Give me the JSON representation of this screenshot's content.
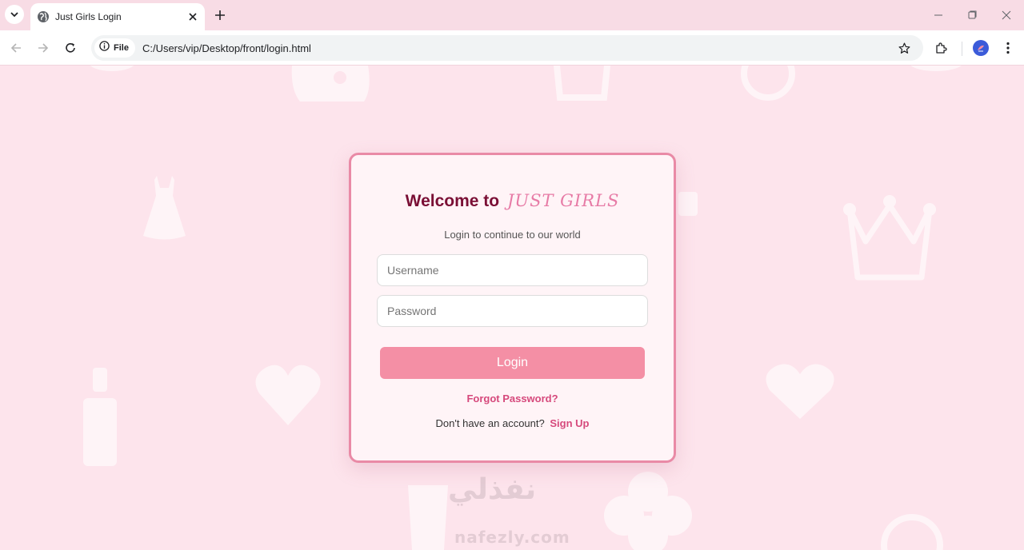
{
  "browser": {
    "tab_title": "Just Girls Login",
    "address_chip": "File",
    "url": "C:/Users/vip/Desktop/front/login.html",
    "icons": [
      "tab-search-icon",
      "globe-icon",
      "close-icon",
      "plus-icon",
      "minimize-icon",
      "restore-icon",
      "window-close-icon",
      "back-arrow-icon",
      "forward-arrow-icon",
      "reload-icon",
      "info-icon",
      "star-icon",
      "extensions-icon",
      "profile-icon",
      "kebab-menu-icon"
    ]
  },
  "login": {
    "welcome_text": "Welcome to",
    "brand": "JUST GIRLS",
    "subtitle": "Login to continue to our world",
    "username_placeholder": "Username",
    "username_value": "",
    "password_placeholder": "Password",
    "password_value": "",
    "login_button": "Login",
    "forgot_password": "Forgot Password?",
    "no_account_text": "Don't have an account?",
    "signup_link": "Sign Up"
  },
  "watermark": {
    "arabic": "نفذلي",
    "latin": "nafezly.com"
  },
  "colors": {
    "page_background": "#fde4ec",
    "card_background": "#fff4f7",
    "card_border": "#e98aa6",
    "heading": "#7a0f35",
    "brand": "#e77ba6",
    "button": "#f48fa5",
    "link": "#d6497c"
  }
}
